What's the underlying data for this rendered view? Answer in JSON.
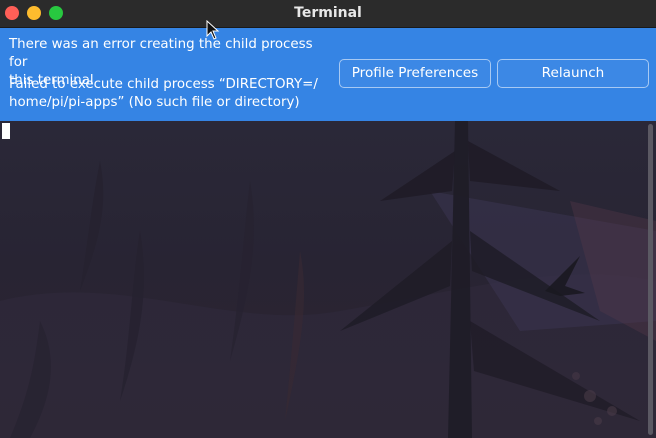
{
  "window": {
    "title": "Terminal"
  },
  "infobar": {
    "primary_text": "There was an error creating the child process for\nthis terminal",
    "secondary_text": "Failed to execute child process “DIRECTORY=/\nhome/pi/pi-apps” (No such file or directory)",
    "profile_button_label": "Profile Preferences",
    "relaunch_button_label": "Relaunch",
    "background_color": "#3584e4"
  },
  "traffic_lights": {
    "close_color": "#ff5f57",
    "minimize_color": "#febc2e",
    "maximize_color": "#28c840"
  }
}
